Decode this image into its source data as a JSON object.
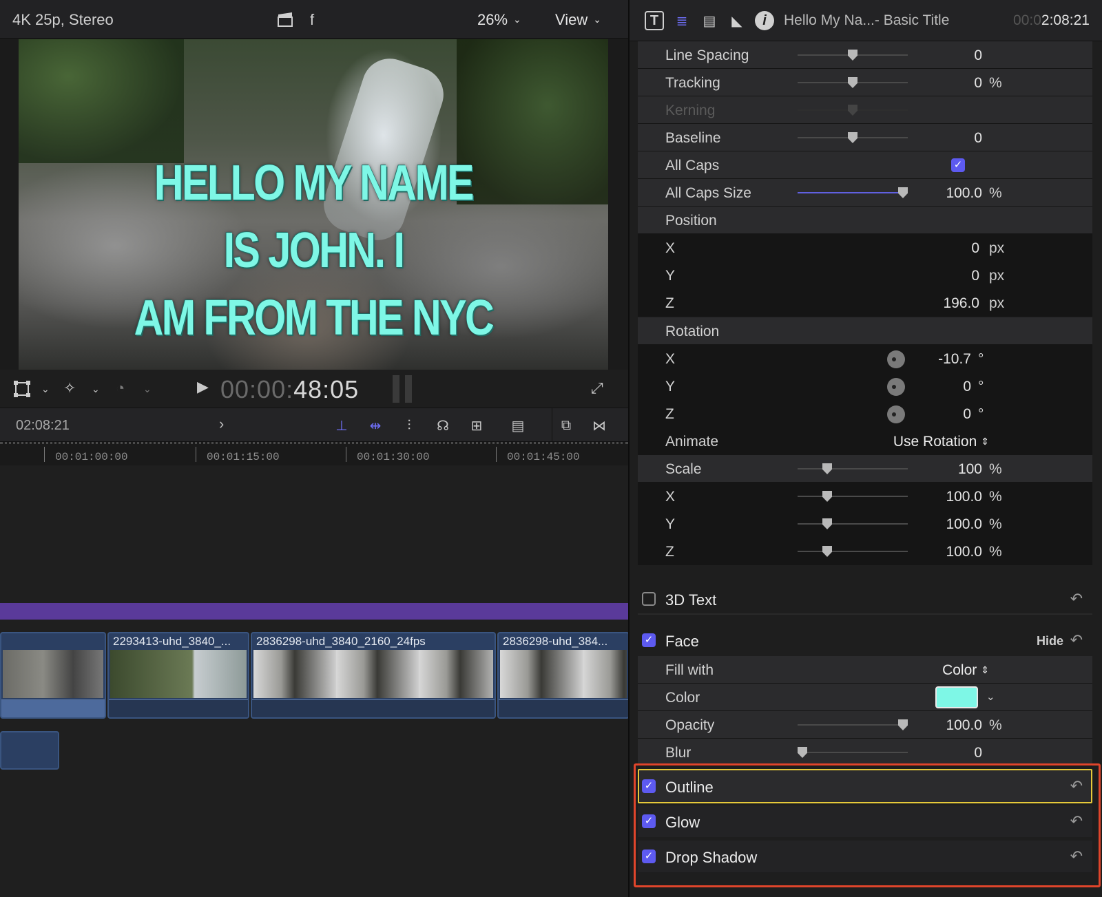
{
  "viewer": {
    "format": "4K 25p, Stereo",
    "f_label": "f",
    "zoom": "26%",
    "view_label": "View",
    "title_lines": [
      "HELLO MY NAME",
      "IS JOHN. I",
      "AM FROM THE NYC"
    ],
    "timecode_dim": "00:00:",
    "timecode_bright": "48:05"
  },
  "timeline": {
    "current_time": "02:08:21",
    "ruler_labels": [
      "00:01:00:00",
      "00:01:15:00",
      "00:01:30:00",
      "00:01:45:00"
    ],
    "clips": [
      {
        "name": ""
      },
      {
        "name": "2293413-uhd_3840_..."
      },
      {
        "name": "2836298-uhd_3840_2160_24fps"
      },
      {
        "name": "2836298-uhd_384..."
      }
    ]
  },
  "inspector": {
    "clip_title": "Hello My Na...- Basic Title",
    "time_dim": "00:0",
    "time_bright": "2:08:21",
    "rows": {
      "line_spacing": {
        "label": "Line Spacing",
        "value": "0"
      },
      "tracking": {
        "label": "Tracking",
        "value": "0",
        "unit": "%"
      },
      "kerning": {
        "label": "Kerning"
      },
      "baseline": {
        "label": "Baseline",
        "value": "0"
      },
      "all_caps": {
        "label": "All Caps",
        "checked": true
      },
      "all_caps_size": {
        "label": "All Caps Size",
        "value": "100.0",
        "unit": "%"
      },
      "position": {
        "label": "Position"
      },
      "pos_x": {
        "label": "X",
        "value": "0",
        "unit": "px"
      },
      "pos_y": {
        "label": "Y",
        "value": "0",
        "unit": "px"
      },
      "pos_z": {
        "label": "Z",
        "value": "196.0",
        "unit": "px"
      },
      "rotation": {
        "label": "Rotation"
      },
      "rot_x": {
        "label": "X",
        "value": "-10.7",
        "unit": "°"
      },
      "rot_y": {
        "label": "Y",
        "value": "0",
        "unit": "°"
      },
      "rot_z": {
        "label": "Z",
        "value": "0",
        "unit": "°"
      },
      "animate": {
        "label": "Animate",
        "value": "Use Rotation"
      },
      "scale": {
        "label": "Scale",
        "value": "100",
        "unit": "%"
      },
      "scale_x": {
        "label": "X",
        "value": "100.0",
        "unit": "%"
      },
      "scale_y": {
        "label": "Y",
        "value": "100.0",
        "unit": "%"
      },
      "scale_z": {
        "label": "Z",
        "value": "100.0",
        "unit": "%"
      },
      "fill_with": {
        "label": "Fill with",
        "value": "Color"
      },
      "color": {
        "label": "Color",
        "swatch": "#7ef7e6"
      },
      "opacity": {
        "label": "Opacity",
        "value": "100.0",
        "unit": "%"
      },
      "blur": {
        "label": "Blur",
        "value": "0"
      }
    },
    "sections": {
      "text3d": {
        "label": "3D Text",
        "checked": false
      },
      "face": {
        "label": "Face",
        "checked": true,
        "hide_label": "Hide"
      },
      "outline": {
        "label": "Outline",
        "checked": true
      },
      "glow": {
        "label": "Glow",
        "checked": true
      },
      "drop_shadow": {
        "label": "Drop Shadow",
        "checked": true
      }
    }
  },
  "colors": {
    "accent": "#5d5af0",
    "title_text": "#7ef7e6",
    "highlight_red": "#e0452b",
    "highlight_yellow": "#e6c93a"
  }
}
